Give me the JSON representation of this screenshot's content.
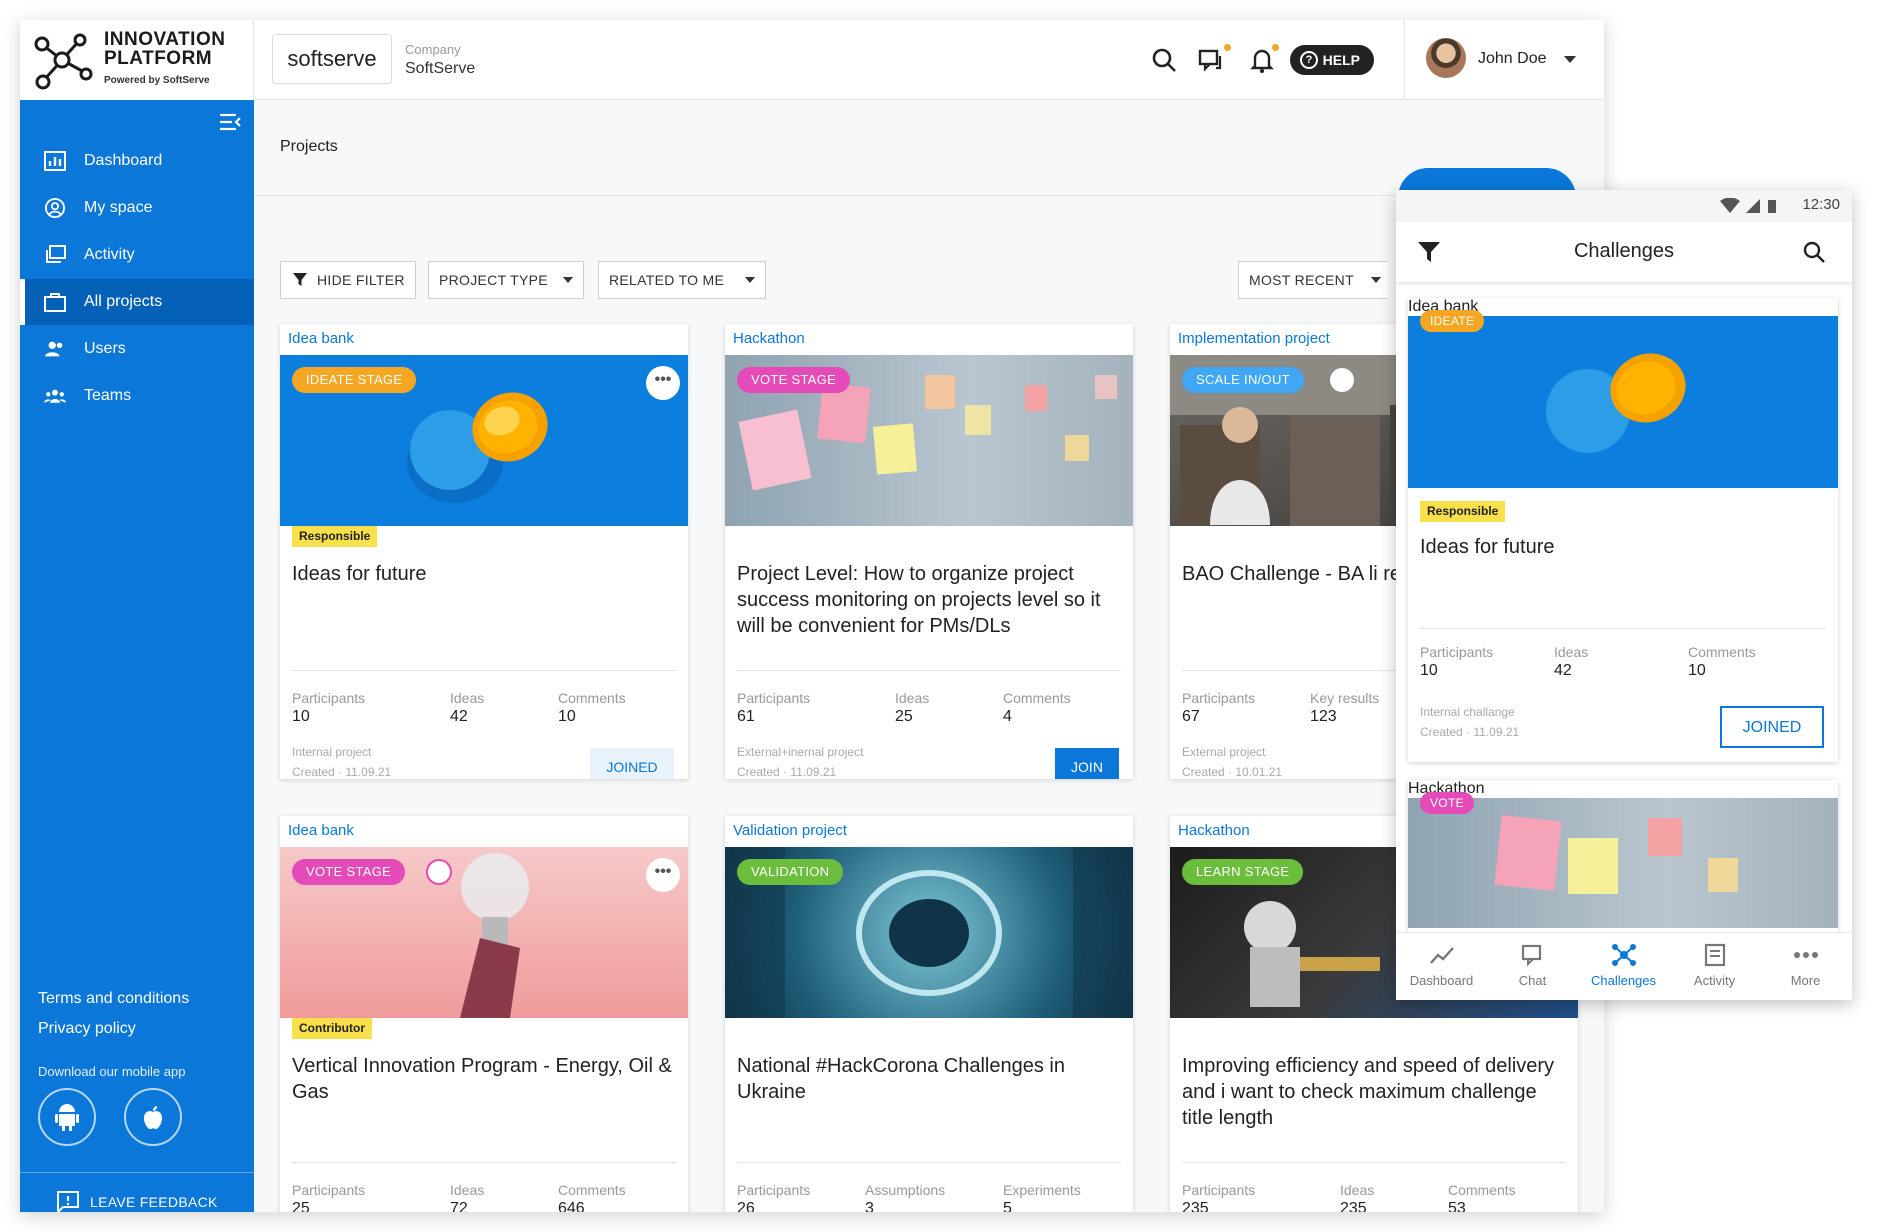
{
  "app": {
    "logo_line1": "INNOVATION",
    "logo_line2": "PLATFORM",
    "logo_sub": "Powered by SoftServe"
  },
  "header": {
    "company_logo": "softserve",
    "company_label": "Company",
    "company_value": "SoftServe",
    "help_label": "HELP",
    "user_name": "John Doe",
    "icons": [
      "search-icon",
      "chat-icon",
      "bell-icon"
    ]
  },
  "sidebar": {
    "items": [
      {
        "label": "Dashboard",
        "icon": "chart-icon"
      },
      {
        "label": "My space",
        "icon": "user-circle-icon"
      },
      {
        "label": "Activity",
        "icon": "activity-icon"
      },
      {
        "label": "All projects",
        "icon": "briefcase-icon",
        "active": true
      },
      {
        "label": "Users",
        "icon": "users-icon"
      },
      {
        "label": "Teams",
        "icon": "teams-icon"
      }
    ],
    "terms": "Terms and conditions",
    "privacy": "Privacy policy",
    "download": "Download our mobile app",
    "feedback": "LEAVE FEEDBACK"
  },
  "main": {
    "breadcrumb": "Projects",
    "filters": {
      "hide": "HIDE FILTER",
      "type": "PROJECT TYPE",
      "related": "RELATED TO ME",
      "sort": "MOST RECENT"
    },
    "cards": [
      {
        "type": "Idea bank",
        "badge": "IDEATE STAGE",
        "role": "Responsible",
        "title": "Ideas for future",
        "s1": "Participants",
        "v1": "10",
        "s2": "Ideas",
        "v2": "42",
        "s3": "Comments",
        "v3": "10",
        "m1": "Internal project",
        "m2": "Created  · 11.09.21",
        "action": "JOINED"
      },
      {
        "type": "Hackathon",
        "badge": "VOTE STAGE",
        "title": "Project Level: How to organize project success monitoring on projects level so it will be convenient for PMs/DLs",
        "s1": "Participants",
        "v1": "61",
        "s2": "Ideas",
        "v2": "25",
        "s3": "Comments",
        "v3": "4",
        "m1": "External+inernal project",
        "m2": "Created  · 11.09.21",
        "action": "JOIN"
      },
      {
        "type": "Implementation project",
        "badge": "SCALE IN/OUT",
        "title": "BAO Challenge - BA li reality",
        "s1": "Participants",
        "v1": "67",
        "s2": "Key results",
        "v2": "123",
        "m1": "External project",
        "m2": "Created  · 10.01.21"
      },
      {
        "type": "Idea bank",
        "badge": "VOTE STAGE",
        "role": "Contributor",
        "title": "Vertical  Innovation Program - Energy, Oil & Gas",
        "s1": "Participants",
        "v1": "25",
        "s2": "Ideas",
        "v2": "72",
        "s3": "Comments",
        "v3": "646"
      },
      {
        "type": "Validation project",
        "badge": "VALIDATION",
        "title": "National #HackCorona Challenges in Ukraine",
        "s1": "Participants",
        "v1": "26",
        "s2": "Assumptions",
        "v2": "3",
        "s3": "Experiments",
        "v3": "5"
      },
      {
        "type": "Hackathon",
        "badge": "LEARN STAGE",
        "title": "Improving efficiency and speed of delivery and i want to check maximum challenge title length",
        "s1": "Participants",
        "v1": "235",
        "s2": "Ideas",
        "v2": "235",
        "s3": "Comments",
        "v3": "53"
      }
    ]
  },
  "phone": {
    "time": "12:30",
    "title": "Challenges",
    "card1": {
      "type": "Idea bank",
      "badge": "IDEATE",
      "role": "Responsible",
      "title": "Ideas for future",
      "s1": "Participants",
      "v1": "10",
      "s2": "Ideas",
      "v2": "42",
      "s3": "Comments",
      "v3": "10",
      "m1": "Internal challange",
      "m2": "Created  · 11.09.21",
      "action": "JOINED"
    },
    "card2": {
      "type": "Hackathon",
      "badge": "VOTE"
    },
    "tabs": [
      {
        "label": "Dashboard",
        "icon": "trend-icon"
      },
      {
        "label": "Chat",
        "icon": "chat-icon"
      },
      {
        "label": "Challenges",
        "icon": "challenges-icon"
      },
      {
        "label": "Activity",
        "icon": "activity-icon"
      },
      {
        "label": "More",
        "icon": "more-icon"
      }
    ]
  },
  "colors": {
    "brand": "#0a77d9",
    "ideate": "#f5a623",
    "vote": "#e44bb8",
    "validation": "#6bbd3c",
    "scale": "#3fa7f5",
    "responsible": "#f8e04a"
  }
}
